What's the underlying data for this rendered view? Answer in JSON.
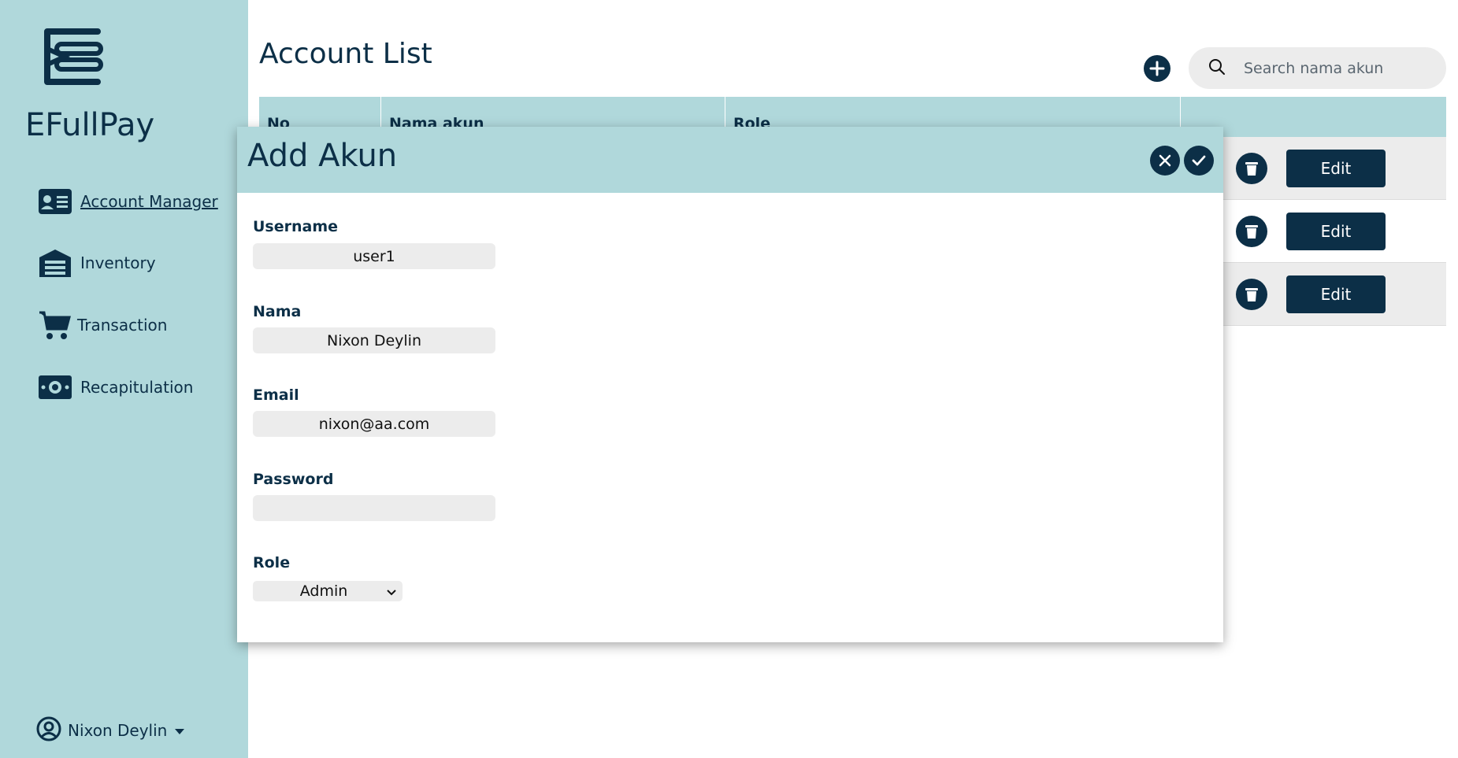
{
  "sidebar": {
    "brand": "EFullPay",
    "items": [
      {
        "label": "Account Manager",
        "icon": "id-card-icon"
      },
      {
        "label": "Inventory",
        "icon": "warehouse-icon"
      },
      {
        "label": "Transaction",
        "icon": "cart-icon"
      },
      {
        "label": "Recapitulation",
        "icon": "money-icon"
      }
    ],
    "user": {
      "name": "Nixon Deylin"
    }
  },
  "main": {
    "title": "Account List",
    "search": {
      "placeholder": "Search nama akun"
    },
    "table": {
      "columns": [
        "No",
        "Nama akun",
        "Role",
        ""
      ],
      "row_action_label": "Edit",
      "row_count": 3
    }
  },
  "modal": {
    "title": "Add Akun",
    "fields": {
      "username": {
        "label": "Username",
        "value": "user1"
      },
      "nama": {
        "label": "Nama",
        "value": "Nixon Deylin"
      },
      "email": {
        "label": "Email",
        "value": "nixon@aa.com"
      },
      "password": {
        "label": "Password",
        "value": ""
      },
      "role": {
        "label": "Role",
        "value": "Admin"
      }
    }
  },
  "colors": {
    "sidebar_bg": "#b0d8db",
    "primary": "#0c2f47",
    "input_bg": "#ececec"
  }
}
